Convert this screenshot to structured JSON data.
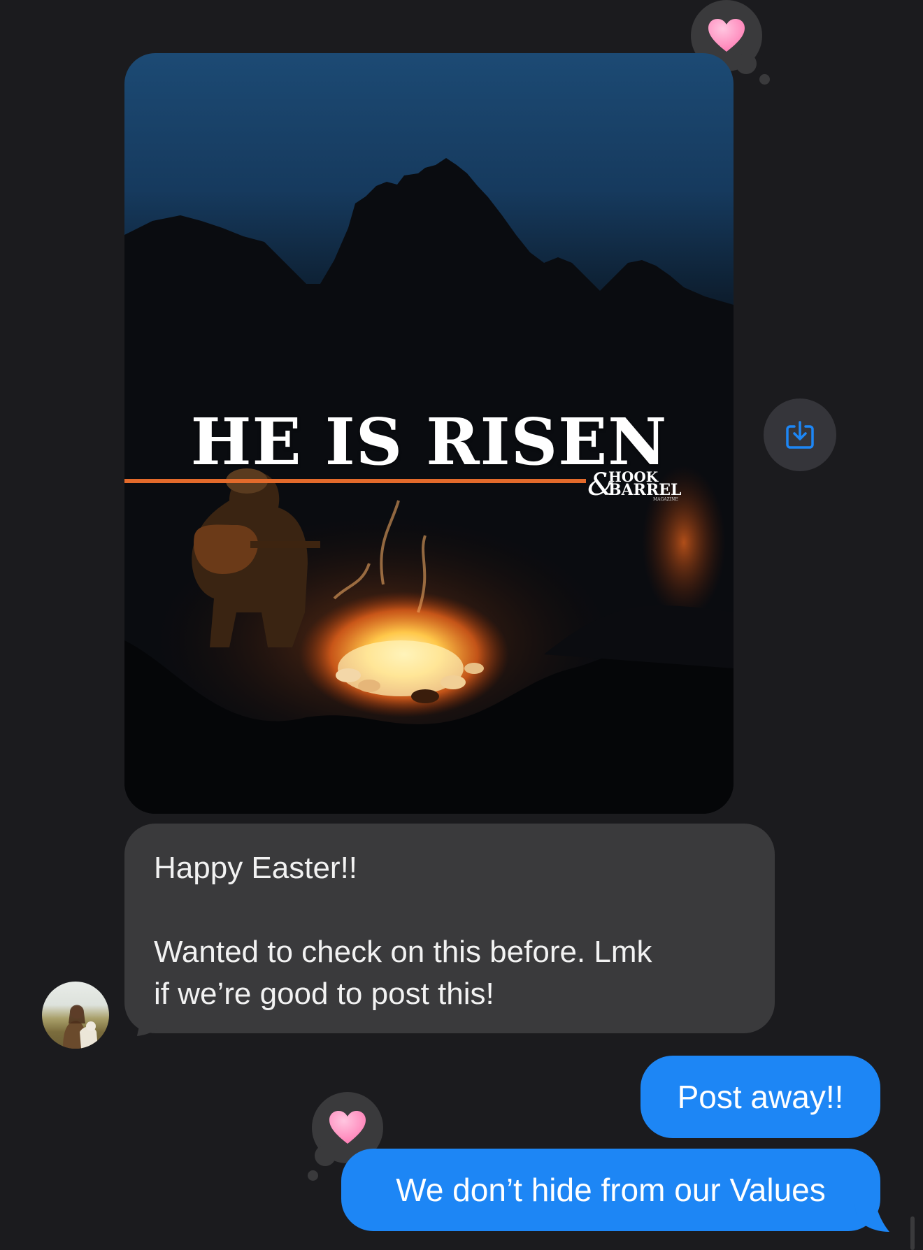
{
  "image_message": {
    "poster_title": "HE IS RISEN",
    "brand_amp": "&",
    "brand_line1": "HOOK",
    "brand_line2": "BARREL",
    "brand_line3": "MAGAZINE",
    "rule_color": "#e36a2b"
  },
  "reactions": [
    {
      "icon": "pink-heart-icon",
      "on": "image_message"
    },
    {
      "icon": "pink-heart-icon",
      "on": "outgoing_message_2"
    }
  ],
  "save_button": {
    "icon": "save-to-photos-icon",
    "color": "#1d86f5"
  },
  "incoming_message": {
    "line1": "Happy Easter!!",
    "line2": "Wanted to check on this before. Lmk",
    "line3": "if we’re good to post this!"
  },
  "outgoing_messages": [
    {
      "text": "Post away!!"
    },
    {
      "text": "We don’t hide from our Values"
    }
  ],
  "colors": {
    "background": "#1b1b1e",
    "incoming_bubble": "#3a3a3c",
    "outgoing_bubble": "#1d86f5",
    "heart": "#ff9cc8"
  }
}
